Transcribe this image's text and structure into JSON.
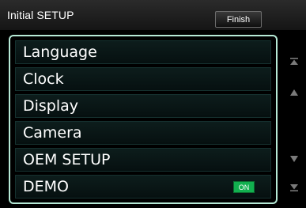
{
  "header": {
    "title": "Initial SETUP",
    "finish_label": "Finish"
  },
  "menu": {
    "items": [
      {
        "label": "Language"
      },
      {
        "label": "Clock"
      },
      {
        "label": "Display"
      },
      {
        "label": "Camera"
      },
      {
        "label": "OEM SETUP"
      },
      {
        "label": "DEMO",
        "badge": "ON"
      }
    ]
  },
  "scrollbar": {
    "icons": [
      "scroll-top-icon",
      "scroll-up-icon",
      "scroll-down-icon",
      "scroll-bottom-icon"
    ]
  },
  "colors": {
    "frame": "#b6e9d6",
    "on_badge": "#12b04f"
  }
}
